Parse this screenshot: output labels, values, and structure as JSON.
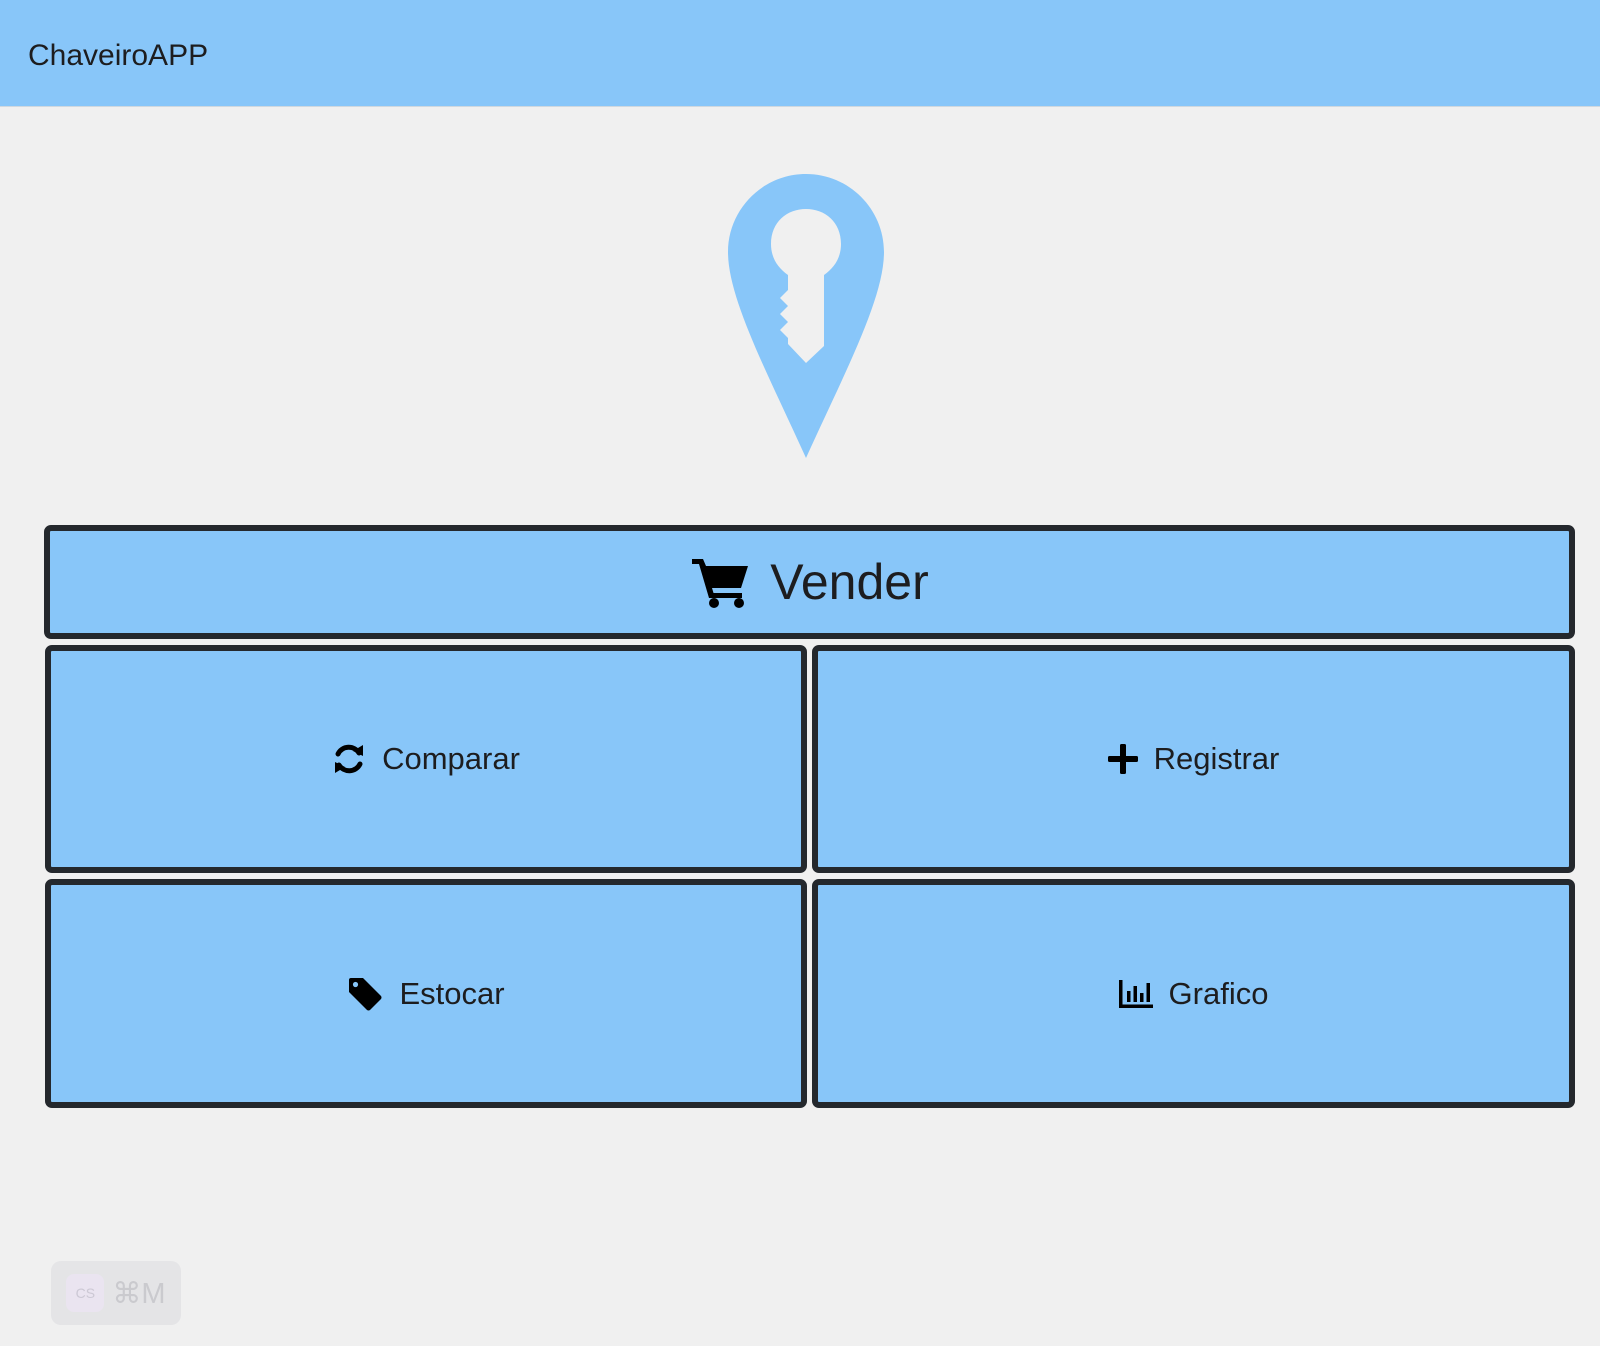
{
  "header": {
    "app_title": "ChaveiroAPP"
  },
  "colors": {
    "primary": "#88c6f9",
    "button_border": "#24282d",
    "background": "#f0f0f0"
  },
  "logo": {
    "icon": "key-location-pin-icon"
  },
  "actions": {
    "vender": {
      "label": "Vender",
      "icon": "shopping-cart-icon"
    },
    "comparar": {
      "label": "Comparar",
      "icon": "refresh-icon"
    },
    "registrar": {
      "label": "Registrar",
      "icon": "plus-icon"
    },
    "estocar": {
      "label": "Estocar",
      "icon": "tag-icon"
    },
    "grafico": {
      "label": "Grafico",
      "icon": "bar-chart-icon"
    }
  },
  "shortcut_badge": {
    "chip": "CS",
    "keys": "⌘M"
  }
}
